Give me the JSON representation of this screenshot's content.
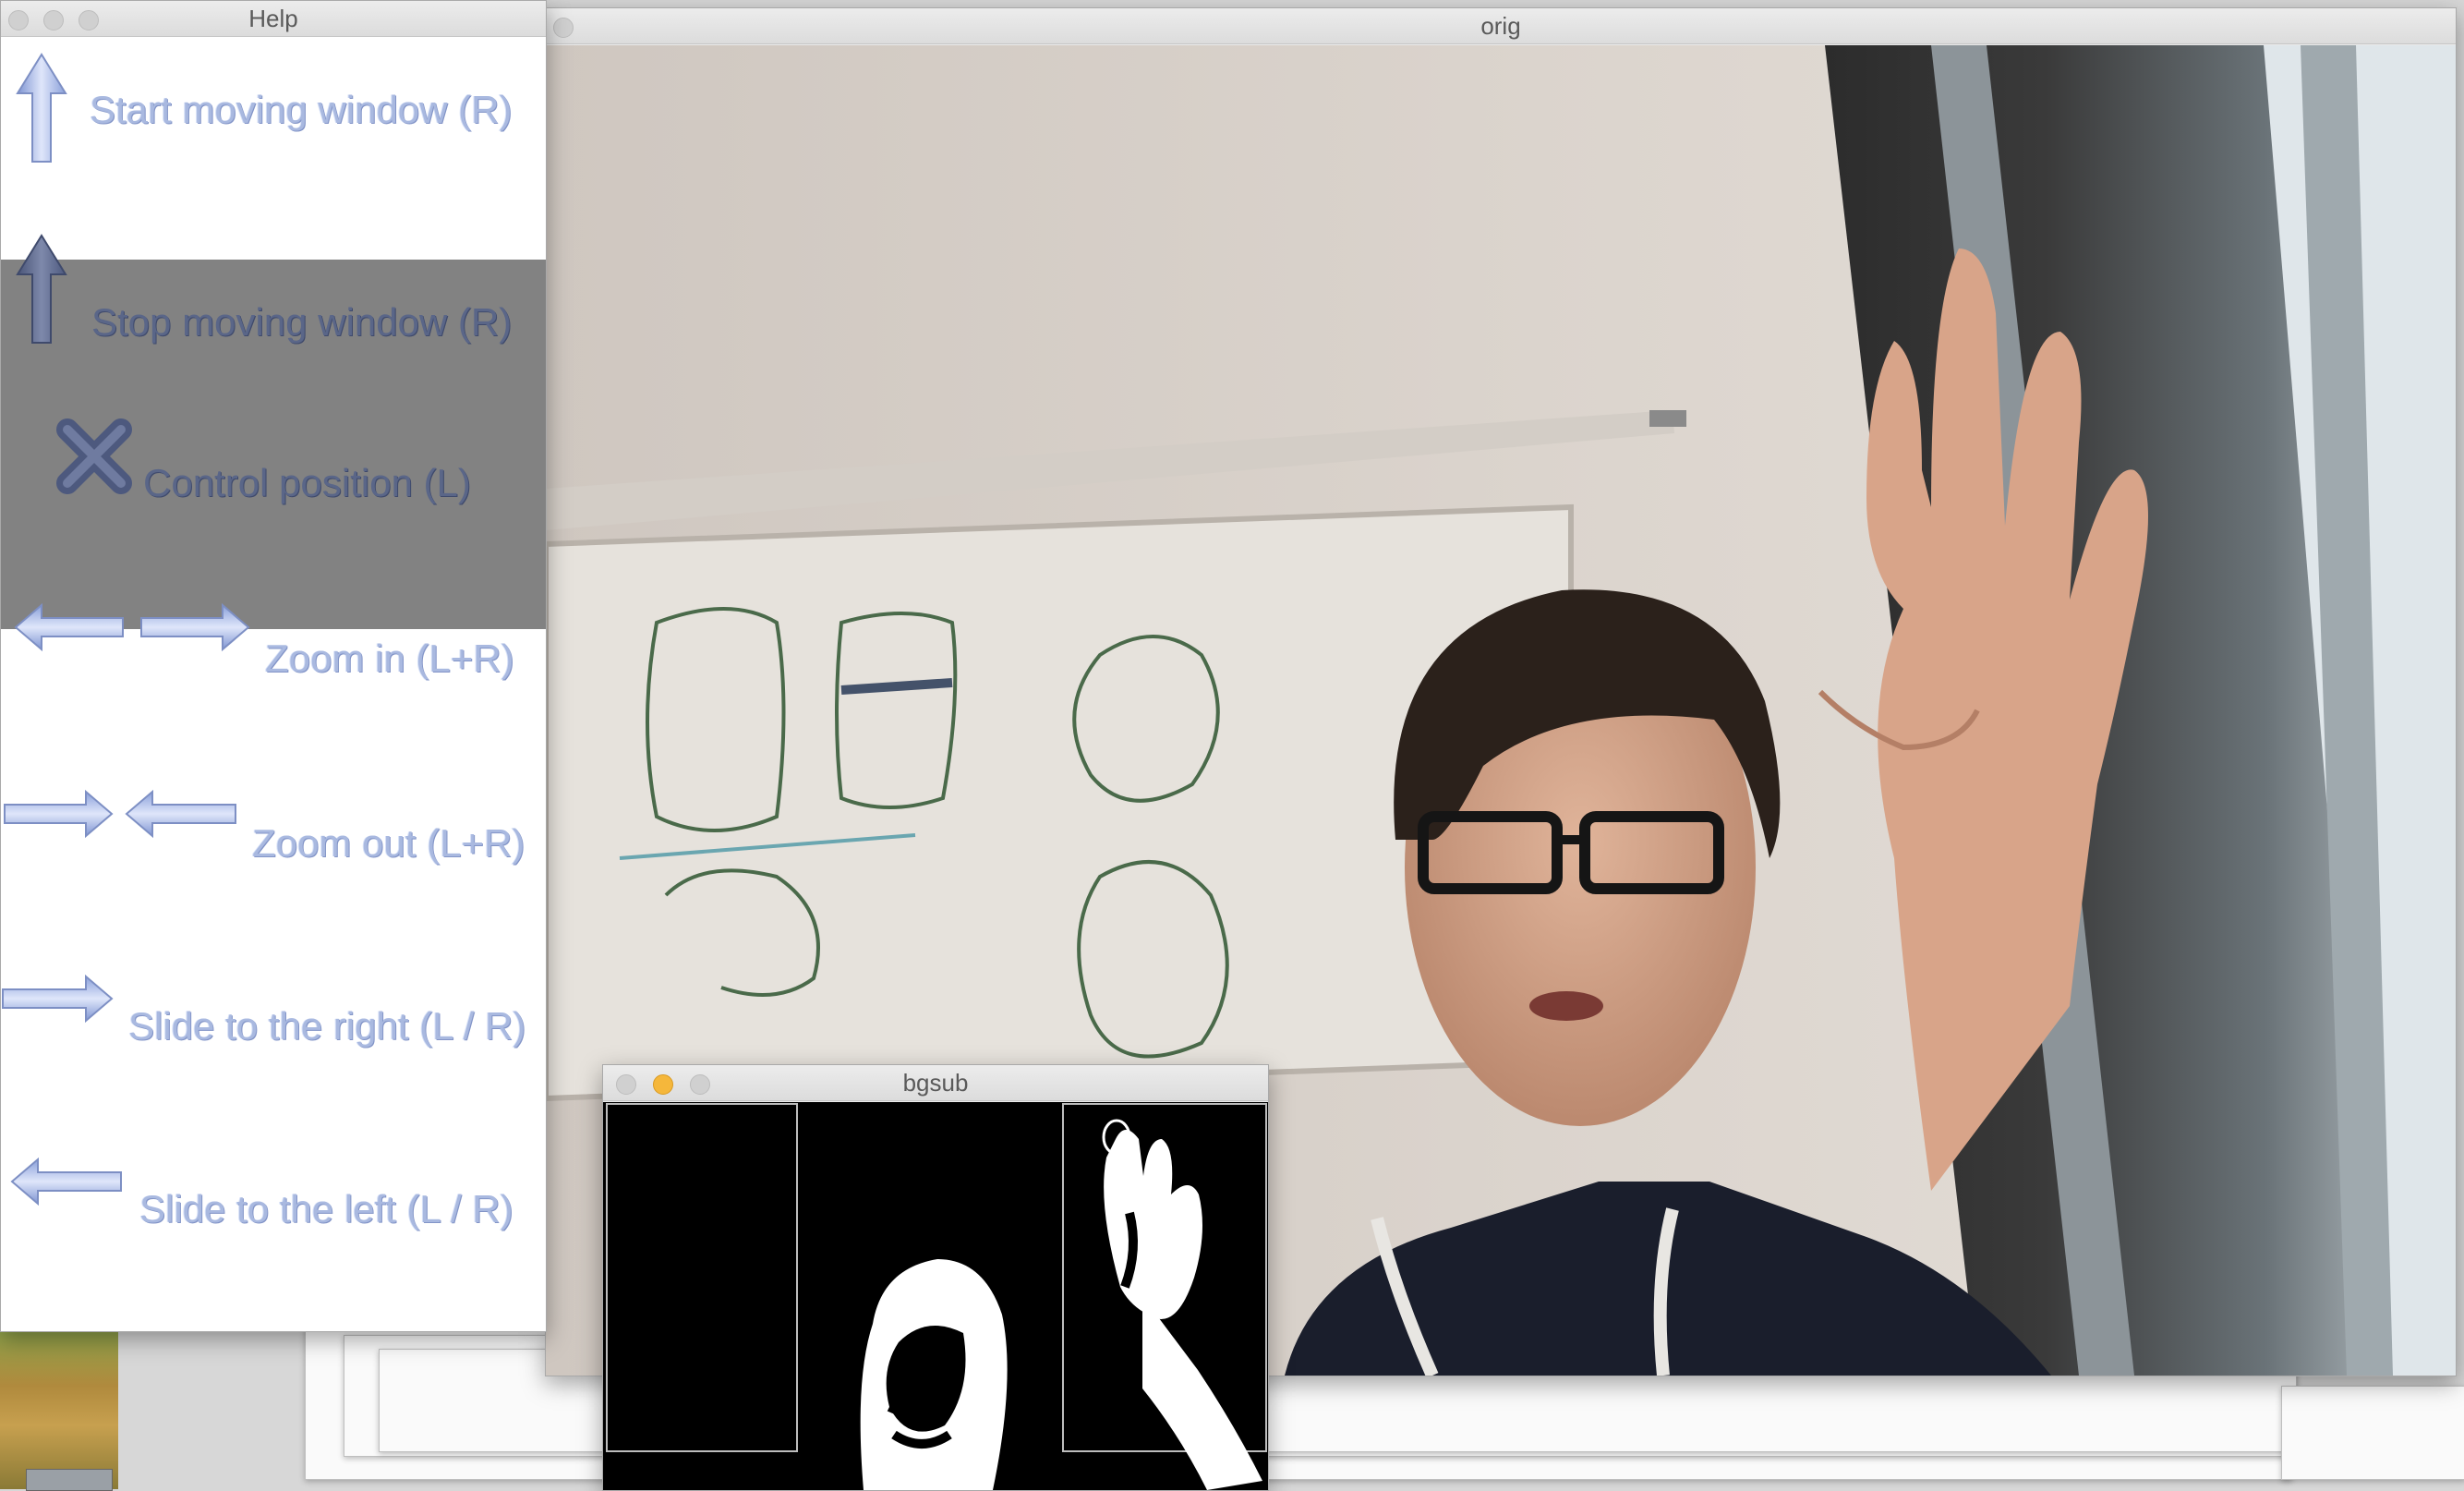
{
  "windows": {
    "help": {
      "title": "Help",
      "items": [
        {
          "label": "Start moving window (R)",
          "icon": "arrow-up-icon"
        },
        {
          "label": "Stop moving window (R)",
          "icon": "arrow-up-icon"
        },
        {
          "label": "Control position (L)",
          "icon": "x-cross-icon"
        },
        {
          "label": "Zoom in (L+R)",
          "icon": "arrows-outward-icon"
        },
        {
          "label": "Zoom out (L+R)",
          "icon": "arrows-inward-icon"
        },
        {
          "label": "Slide to the right (L / R)",
          "icon": "arrow-right-icon"
        },
        {
          "label": "Slide to the left (L / R)",
          "icon": "arrow-left-icon"
        }
      ]
    },
    "orig": {
      "title": "orig"
    },
    "bgsub": {
      "title": "bgsub"
    }
  },
  "colors": {
    "help_highlight_panel": "#828282",
    "arrow_light": "#a9b9e0",
    "arrow_dark": "#5a6688",
    "minimize_yellow": "#f5b73b"
  }
}
